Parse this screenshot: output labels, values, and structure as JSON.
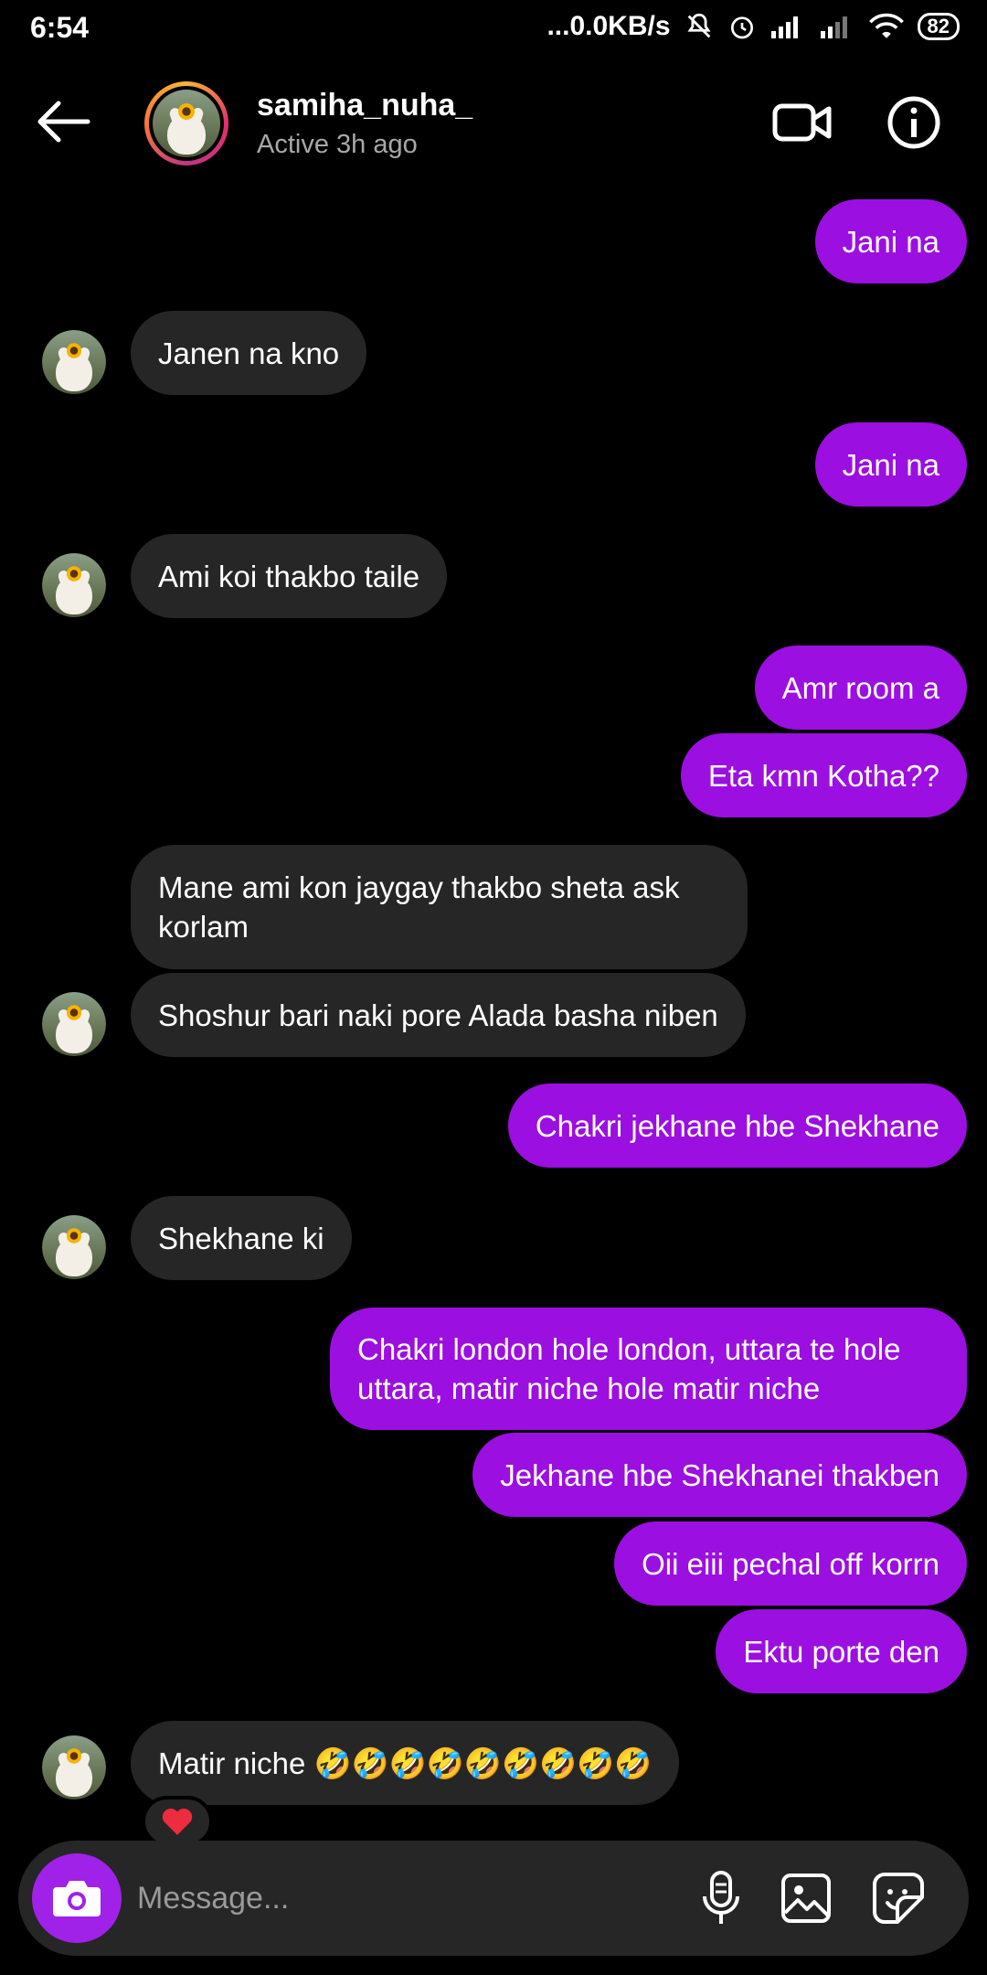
{
  "status_bar": {
    "time": "6:54",
    "network_speed": "...0.0KB/s",
    "battery": "82"
  },
  "header": {
    "username": "samiha_nuha_",
    "status": "Active 3h ago"
  },
  "messages": [
    {
      "from": "me",
      "text": "Jani na"
    },
    {
      "from": "them",
      "text": "Janen na kno"
    },
    {
      "from": "me",
      "text": "Jani na"
    },
    {
      "from": "them",
      "text": "Ami koi thakbo taile"
    },
    {
      "from": "me",
      "text": "Amr room a"
    },
    {
      "from": "me",
      "text": "Eta kmn Kotha??"
    },
    {
      "from": "them",
      "text": "Mane ami kon jaygay thakbo sheta ask korlam"
    },
    {
      "from": "them",
      "text": "Shoshur bari naki pore Alada basha niben"
    },
    {
      "from": "me",
      "text": "Chakri jekhane hbe Shekhane"
    },
    {
      "from": "them",
      "text": "Shekhane ki"
    },
    {
      "from": "me",
      "text": "Chakri london hole london, uttara te hole uttara, matir niche hole matir niche"
    },
    {
      "from": "me",
      "text": "Jekhane hbe Shekhanei thakben"
    },
    {
      "from": "me",
      "text": "Oii eiii pechal off korrn"
    },
    {
      "from": "me",
      "text": "Ektu porte den"
    },
    {
      "from": "them",
      "text": "Matir niche 🤣🤣🤣🤣🤣🤣🤣🤣🤣"
    }
  ],
  "reaction": "❤️",
  "composer": {
    "placeholder": "Message..."
  },
  "colors": {
    "sent_bubble": "#9b0fe0",
    "received_bubble": "#262626",
    "camera_button": "#a021e8"
  }
}
